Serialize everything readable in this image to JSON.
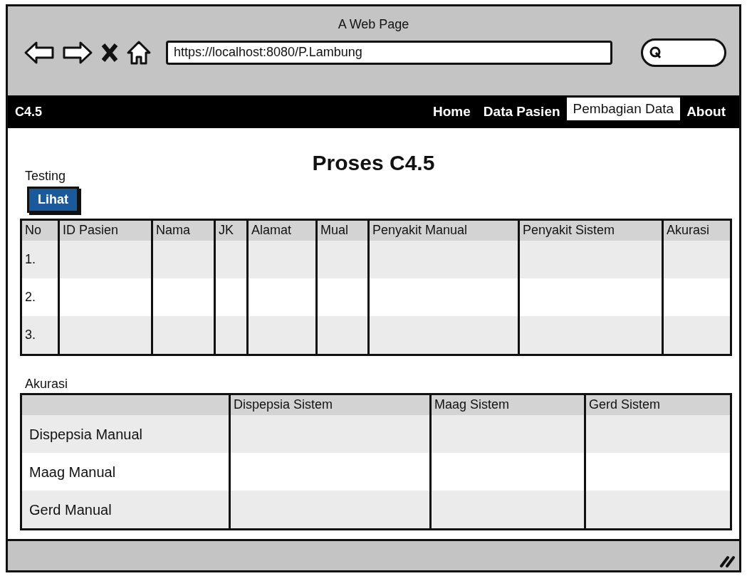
{
  "window": {
    "title": "A Web Page"
  },
  "browser": {
    "url": "https://localhost:8080/P.Lambung"
  },
  "navbar": {
    "brand": "C4.5",
    "items": [
      {
        "label": "Home",
        "selected": false
      },
      {
        "label": "Data Pasien",
        "selected": false
      },
      {
        "label": "Pembagian Data",
        "selected": true
      },
      {
        "label": "About",
        "selected": false
      }
    ]
  },
  "page": {
    "title": "Proses C4.5",
    "section": "Testing",
    "button": "Lihat"
  },
  "testing_table": {
    "columns": [
      "No",
      "ID Pasien",
      "Nama",
      "JK",
      "Alamat",
      "Mual",
      "Penyakit Manual",
      "Penyakit Sistem",
      "Akurasi"
    ],
    "rows": [
      [
        "1."
      ],
      [
        "2."
      ],
      [
        "3."
      ]
    ]
  },
  "accuracy": {
    "label": "Akurasi",
    "columns": [
      "Dispepsia Sistem",
      "Maag Sistem",
      "Gerd Sistem"
    ],
    "rows": [
      "Dispepsia Manual",
      "Maag Manual",
      "Gerd Manual"
    ]
  }
}
